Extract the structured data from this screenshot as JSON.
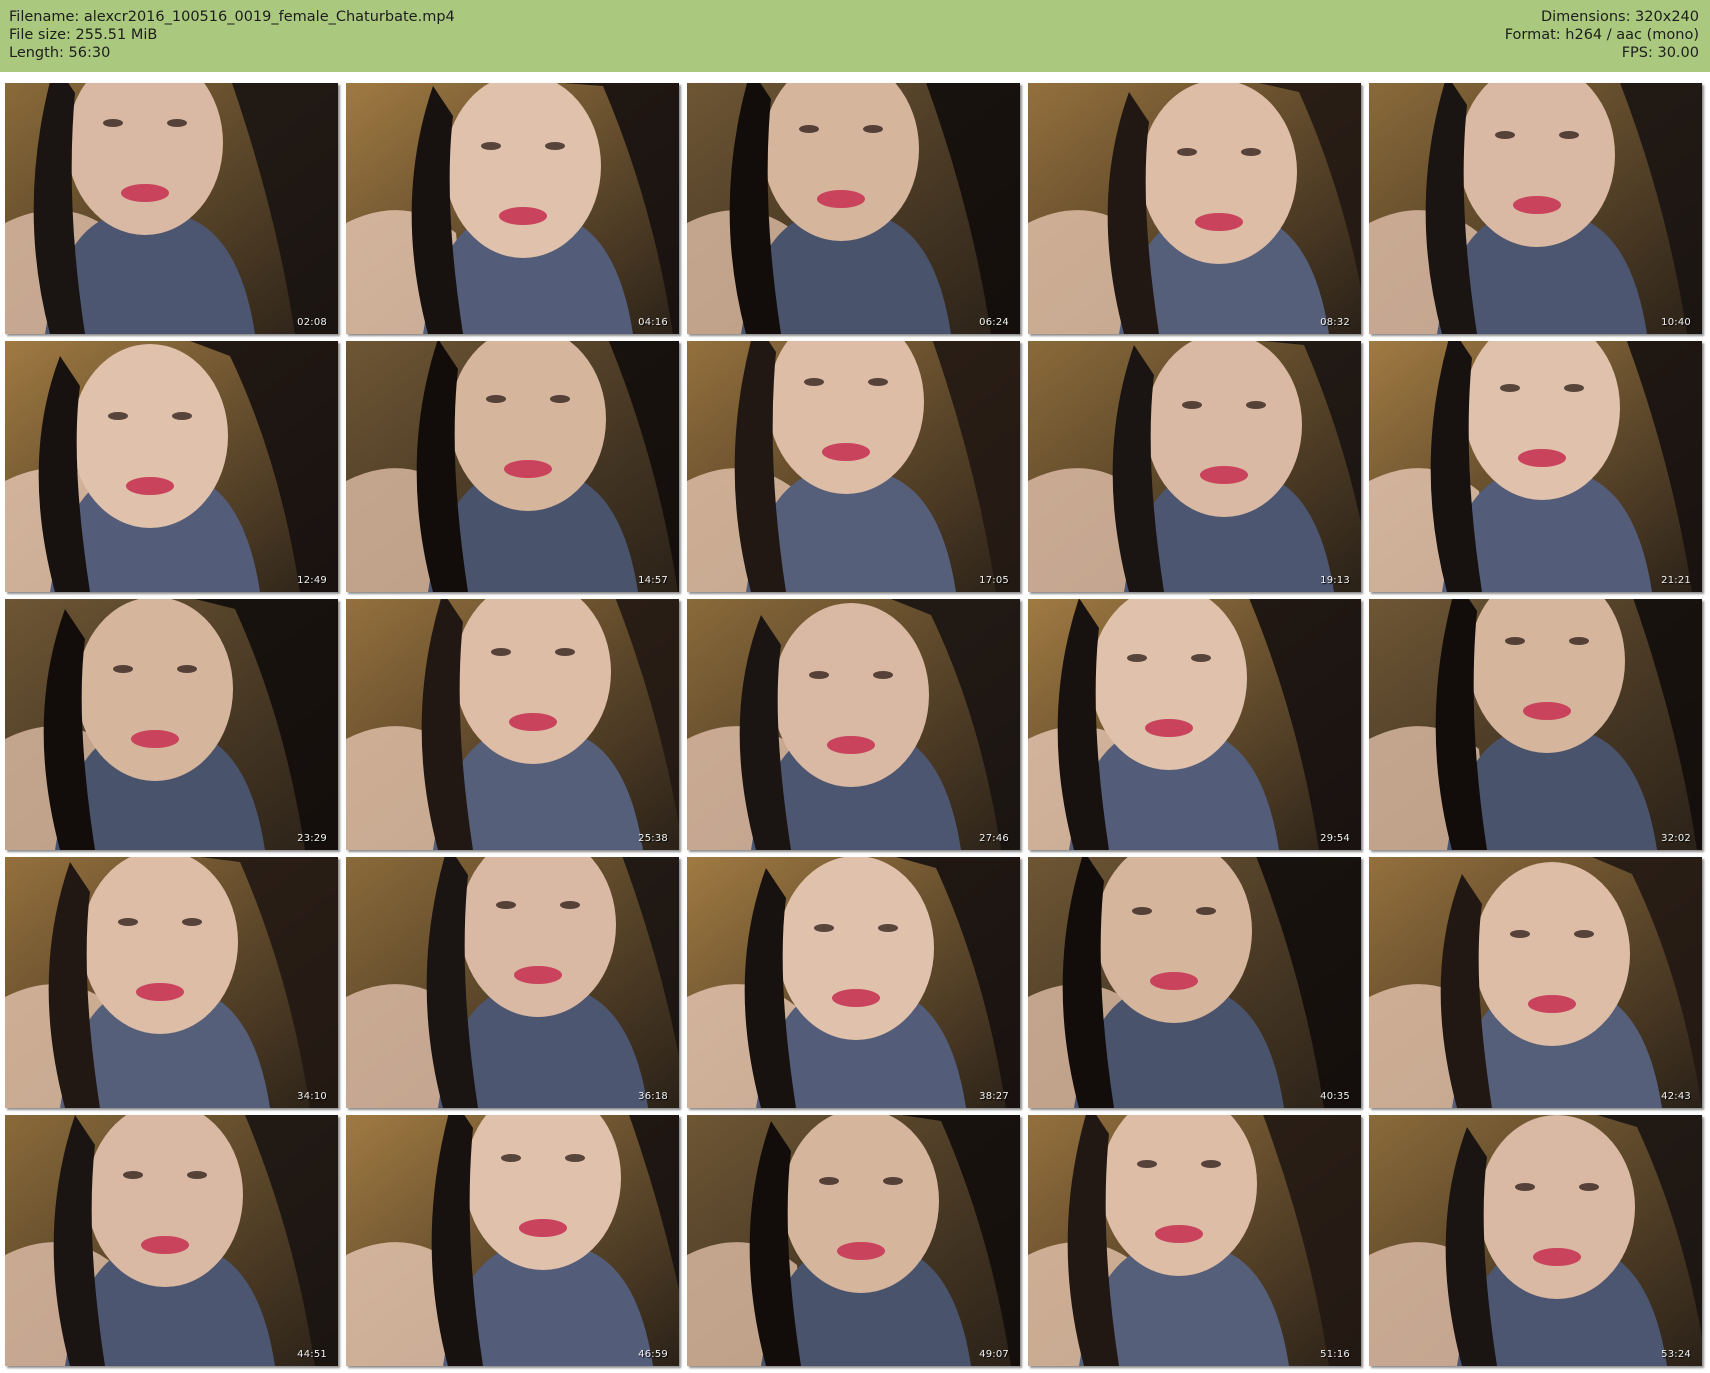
{
  "header": {
    "filename_line": "Filename: alexcr2016_100516_0019_female_Chaturbate.mp4",
    "filesize_line": "File size: 255.51 MiB",
    "length_line": "Length: 56:30",
    "dimensions_line": "Dimensions: 320x240",
    "format_line": "Format: h264 / aac (mono)",
    "fps_line": "FPS: 30.00"
  },
  "colors": {
    "header_bg": "#abc97e",
    "page_bg": "#ffffff"
  },
  "thumbnails": [
    {
      "timestamp": "02:08"
    },
    {
      "timestamp": "04:16"
    },
    {
      "timestamp": "06:24"
    },
    {
      "timestamp": "08:32"
    },
    {
      "timestamp": "10:40"
    },
    {
      "timestamp": "12:49"
    },
    {
      "timestamp": "14:57"
    },
    {
      "timestamp": "17:05"
    },
    {
      "timestamp": "19:13"
    },
    {
      "timestamp": "21:21"
    },
    {
      "timestamp": "23:29"
    },
    {
      "timestamp": "25:38"
    },
    {
      "timestamp": "27:46"
    },
    {
      "timestamp": "29:54"
    },
    {
      "timestamp": "32:02"
    },
    {
      "timestamp": "34:10"
    },
    {
      "timestamp": "36:18"
    },
    {
      "timestamp": "38:27"
    },
    {
      "timestamp": "40:35"
    },
    {
      "timestamp": "42:43"
    },
    {
      "timestamp": "44:51"
    },
    {
      "timestamp": "46:59"
    },
    {
      "timestamp": "49:07"
    },
    {
      "timestamp": "51:16"
    },
    {
      "timestamp": "53:24"
    }
  ]
}
